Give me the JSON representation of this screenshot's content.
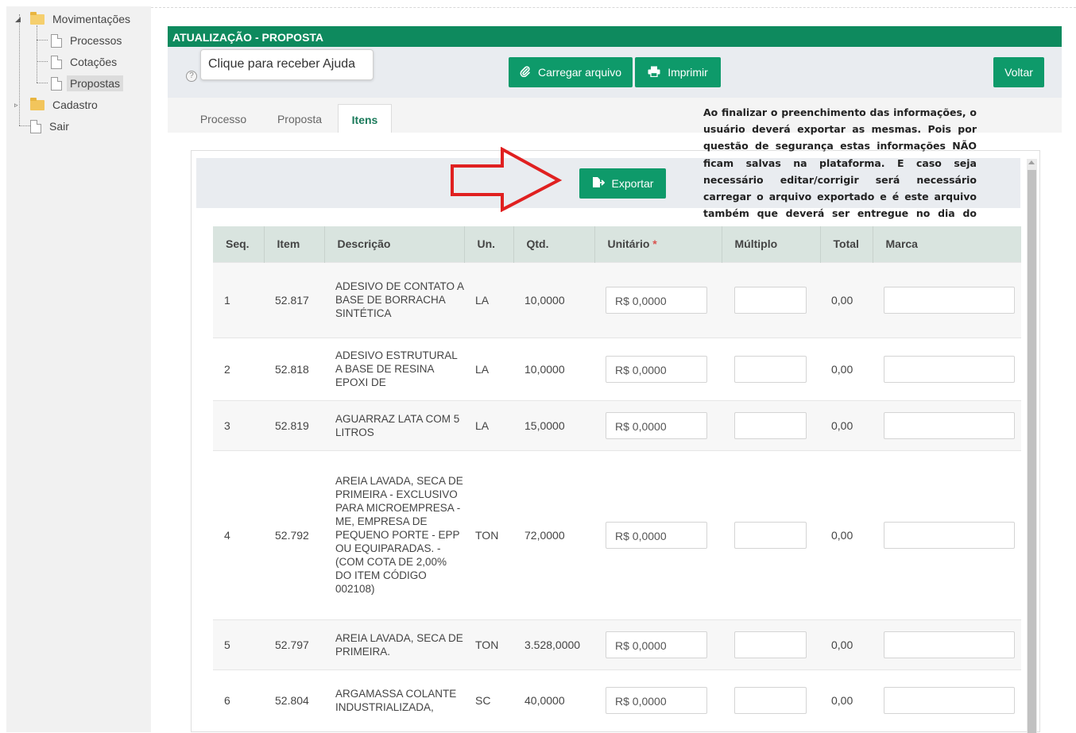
{
  "tree": {
    "root": "Movimentações",
    "children": [
      "Processos",
      "Cotações",
      "Propostas"
    ],
    "cadastro": "Cadastro",
    "sair": "Sair"
  },
  "panel": {
    "title": "ATUALIZAÇÃO - PROPOSTA",
    "help_icon": "?",
    "help_tooltip": "Clique para receber Ajuda",
    "buttons": {
      "upload": "Carregar arquivo",
      "print": "Imprimir",
      "back": "Voltar",
      "export": "Exportar"
    },
    "tabs": [
      "Processo",
      "Proposta",
      "Itens"
    ],
    "active_tab": "Itens",
    "info_text": "Ao finalizar o preenchimento das informações, o usuário deverá exportar as mesmas. Pois por questão de segurança estas informações NÃO ficam salvas na plataforma. E caso seja necessário editar/corrigir será necessário carregar o arquivo exportado e é este arquivo também que deverá ser entregue no dia do certame."
  },
  "table": {
    "headers": {
      "seq": "Seq.",
      "item": "Item",
      "descricao": "Descrição",
      "un": "Un.",
      "qtd": "Qtd.",
      "unitario": "Unitário",
      "required_mark": "*",
      "multiplo": "Múltiplo",
      "total": "Total",
      "marca": "Marca"
    },
    "rows": [
      {
        "seq": "1",
        "item": "52.817",
        "descricao": "ADESIVO DE CONTATO A BASE DE BORRACHA SINTÉTICA",
        "un": "LA",
        "qtd": "10,0000",
        "unitario": "R$ 0,0000",
        "total": "0,00"
      },
      {
        "seq": "2",
        "item": "52.818",
        "descricao": "ADESIVO ESTRUTURAL A BASE DE RESINA EPOXI DE",
        "un": "LA",
        "qtd": "10,0000",
        "unitario": "R$ 0,0000",
        "total": "0,00"
      },
      {
        "seq": "3",
        "item": "52.819",
        "descricao": "AGUARRAZ LATA COM 5 LITROS",
        "un": "LA",
        "qtd": "15,0000",
        "unitario": "R$ 0,0000",
        "total": "0,00"
      },
      {
        "seq": "4",
        "item": "52.792",
        "descricao": "AREIA LAVADA, SECA DE PRIMEIRA - EXCLUSIVO PARA MICROEMPRESA - ME, EMPRESA DE PEQUENO PORTE - EPP OU EQUIPARADAS. - (COM COTA DE 2,00% DO ITEM CÓDIGO 002108)",
        "un": "TON",
        "qtd": "72,0000",
        "unitario": "R$ 0,0000",
        "total": "0,00"
      },
      {
        "seq": "5",
        "item": "52.797",
        "descricao": "AREIA LAVADA, SECA DE PRIMEIRA.",
        "un": "TON",
        "qtd": "3.528,0000",
        "unitario": "R$ 0,0000",
        "total": "0,00"
      },
      {
        "seq": "6",
        "item": "52.804",
        "descricao": "ARGAMASSA COLANTE INDUSTRIALIZADA,",
        "un": "SC",
        "qtd": "40,0000",
        "unitario": "R$ 0,0000",
        "total": "0,00"
      }
    ]
  },
  "colors": {
    "brand_green": "#0e8a5e",
    "button_green": "#0e9a6a",
    "arrow_red": "#e02020"
  },
  "icons": {
    "upload": "paperclip-icon",
    "print": "printer-icon",
    "export": "file-export-icon"
  }
}
